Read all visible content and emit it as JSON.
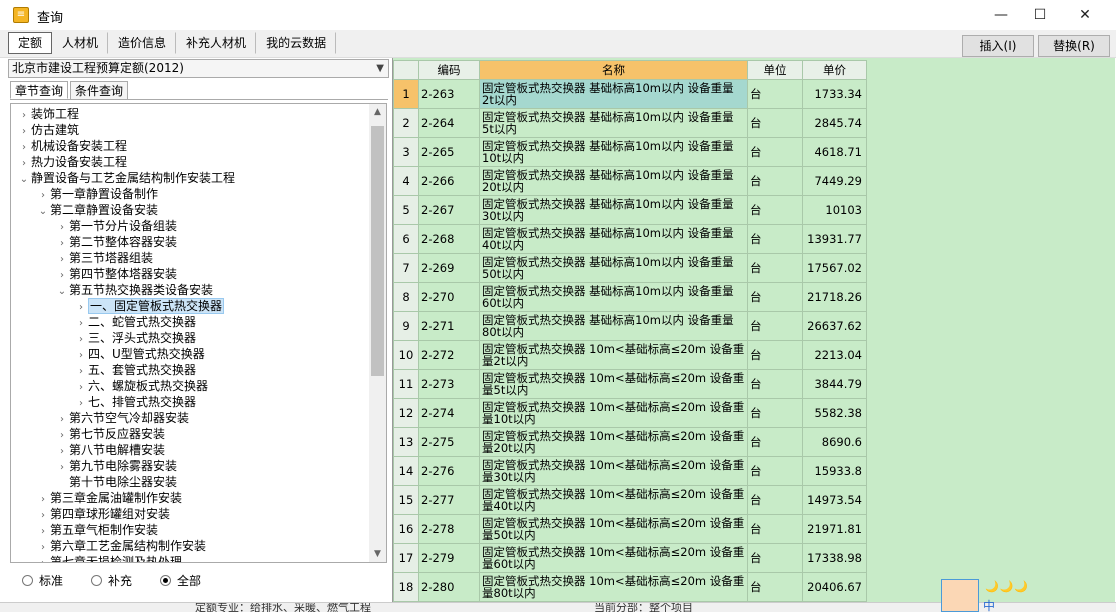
{
  "window": {
    "title": "查询",
    "app_icon": "ledger-app-icon"
  },
  "toolbar": {
    "tabs": [
      "定额",
      "人材机",
      "造价信息",
      "补充人材机",
      "我的云数据"
    ],
    "active_tab": 0,
    "insert_label": "插入(I)",
    "replace_label": "替换(R)"
  },
  "left": {
    "dropdown_value": "北京市建设工程预算定额(2012)",
    "subtabs": [
      "章节查询",
      "条件查询"
    ],
    "tree": [
      {
        "label": "装饰工程",
        "level": 0,
        "arrow": "collapsed"
      },
      {
        "label": "仿古建筑",
        "level": 0,
        "arrow": "collapsed"
      },
      {
        "label": "机械设备安装工程",
        "level": 0,
        "arrow": "collapsed"
      },
      {
        "label": "热力设备安装工程",
        "level": 0,
        "arrow": "collapsed"
      },
      {
        "label": "静置设备与工艺金属结构制作安装工程",
        "level": 0,
        "arrow": "expanded"
      },
      {
        "label": "第一章静置设备制作",
        "level": 1,
        "arrow": "collapsed"
      },
      {
        "label": "第二章静置设备安装",
        "level": 1,
        "arrow": "expanded"
      },
      {
        "label": "第一节分片设备组装",
        "level": 2,
        "arrow": "collapsed"
      },
      {
        "label": "第二节整体容器安装",
        "level": 2,
        "arrow": "collapsed"
      },
      {
        "label": "第三节塔器组装",
        "level": 2,
        "arrow": "collapsed"
      },
      {
        "label": "第四节整体塔器安装",
        "level": 2,
        "arrow": "collapsed"
      },
      {
        "label": "第五节热交换器类设备安装",
        "level": 2,
        "arrow": "expanded"
      },
      {
        "label": "一、固定管板式热交换器",
        "level": 3,
        "arrow": "collapsed",
        "selected": true
      },
      {
        "label": "二、蛇管式热交换器",
        "level": 3,
        "arrow": "collapsed"
      },
      {
        "label": "三、浮头式热交换器",
        "level": 3,
        "arrow": "collapsed"
      },
      {
        "label": "四、U型管式热交换器",
        "level": 3,
        "arrow": "collapsed"
      },
      {
        "label": "五、套管式热交换器",
        "level": 3,
        "arrow": "collapsed"
      },
      {
        "label": "六、螺旋板式热交换器",
        "level": 3,
        "arrow": "collapsed"
      },
      {
        "label": "七、排管式热交换器",
        "level": 3,
        "arrow": "collapsed"
      },
      {
        "label": "第六节空气冷却器安装",
        "level": 2,
        "arrow": "collapsed"
      },
      {
        "label": "第七节反应器安装",
        "level": 2,
        "arrow": "collapsed"
      },
      {
        "label": "第八节电解槽安装",
        "level": 2,
        "arrow": "collapsed"
      },
      {
        "label": "第九节电除雾器安装",
        "level": 2,
        "arrow": "collapsed"
      },
      {
        "label": "第十节电除尘器安装",
        "level": 2,
        "arrow": "none"
      },
      {
        "label": "第三章金属油罐制作安装",
        "level": 1,
        "arrow": "collapsed"
      },
      {
        "label": "第四章球形罐组对安装",
        "level": 1,
        "arrow": "collapsed"
      },
      {
        "label": "第五章气柜制作安装",
        "level": 1,
        "arrow": "collapsed"
      },
      {
        "label": "第六章工艺金属结构制作安装",
        "level": 1,
        "arrow": "collapsed"
      },
      {
        "label": "第七章无损检测及热处理",
        "level": 1,
        "arrow": "collapsed"
      }
    ],
    "radios": [
      {
        "label": "标准",
        "checked": false
      },
      {
        "label": "补充",
        "checked": false
      },
      {
        "label": "全部",
        "checked": true
      }
    ]
  },
  "grid": {
    "headers": [
      "",
      "编码",
      "名称",
      "单位",
      "单价"
    ],
    "rows": [
      {
        "idx": "1",
        "code": "2-263",
        "name": "固定管板式热交换器 基础标高10m以内 设备重量2t以内",
        "unit": "台",
        "price": "1733.34"
      },
      {
        "idx": "2",
        "code": "2-264",
        "name": "固定管板式热交换器 基础标高10m以内 设备重量5t以内",
        "unit": "台",
        "price": "2845.74"
      },
      {
        "idx": "3",
        "code": "2-265",
        "name": "固定管板式热交换器 基础标高10m以内 设备重量10t以内",
        "unit": "台",
        "price": "4618.71"
      },
      {
        "idx": "4",
        "code": "2-266",
        "name": "固定管板式热交换器 基础标高10m以内 设备重量20t以内",
        "unit": "台",
        "price": "7449.29"
      },
      {
        "idx": "5",
        "code": "2-267",
        "name": "固定管板式热交换器 基础标高10m以内 设备重量30t以内",
        "unit": "台",
        "price": "10103"
      },
      {
        "idx": "6",
        "code": "2-268",
        "name": "固定管板式热交换器 基础标高10m以内 设备重量40t以内",
        "unit": "台",
        "price": "13931.77"
      },
      {
        "idx": "7",
        "code": "2-269",
        "name": "固定管板式热交换器 基础标高10m以内 设备重量50t以内",
        "unit": "台",
        "price": "17567.02"
      },
      {
        "idx": "8",
        "code": "2-270",
        "name": "固定管板式热交换器 基础标高10m以内 设备重量60t以内",
        "unit": "台",
        "price": "21718.26"
      },
      {
        "idx": "9",
        "code": "2-271",
        "name": "固定管板式热交换器 基础标高10m以内 设备重量80t以内",
        "unit": "台",
        "price": "26637.62"
      },
      {
        "idx": "10",
        "code": "2-272",
        "name": "固定管板式热交换器 10m<基础标高≤20m 设备重量2t以内",
        "unit": "台",
        "price": "2213.04"
      },
      {
        "idx": "11",
        "code": "2-273",
        "name": "固定管板式热交换器 10m<基础标高≤20m 设备重量5t以内",
        "unit": "台",
        "price": "3844.79"
      },
      {
        "idx": "12",
        "code": "2-274",
        "name": "固定管板式热交换器 10m<基础标高≤20m 设备重量10t以内",
        "unit": "台",
        "price": "5582.38"
      },
      {
        "idx": "13",
        "code": "2-275",
        "name": "固定管板式热交换器 10m<基础标高≤20m 设备重量20t以内",
        "unit": "台",
        "price": "8690.6"
      },
      {
        "idx": "14",
        "code": "2-276",
        "name": "固定管板式热交换器 10m<基础标高≤20m 设备重量30t以内",
        "unit": "台",
        "price": "15933.8"
      },
      {
        "idx": "15",
        "code": "2-277",
        "name": "固定管板式热交换器 10m<基础标高≤20m 设备重量40t以内",
        "unit": "台",
        "price": "14973.54"
      },
      {
        "idx": "16",
        "code": "2-278",
        "name": "固定管板式热交换器 10m<基础标高≤20m 设备重量50t以内",
        "unit": "台",
        "price": "21971.81"
      },
      {
        "idx": "17",
        "code": "2-279",
        "name": "固定管板式热交换器 10m<基础标高≤20m 设备重量60t以内",
        "unit": "台",
        "price": "17338.98"
      },
      {
        "idx": "18",
        "code": "2-280",
        "name": "固定管板式热交换器 10m<基础标高≤20m 设备重量80t以内",
        "unit": "台",
        "price": "20406.67"
      }
    ],
    "selected_row": 0
  },
  "status": {
    "left": "定额专业：给排水、采暖、燃气工程",
    "right": "当前分部：整个项目"
  },
  "ime": {
    "label": "中",
    "moons": "🌙🌙🌙"
  }
}
